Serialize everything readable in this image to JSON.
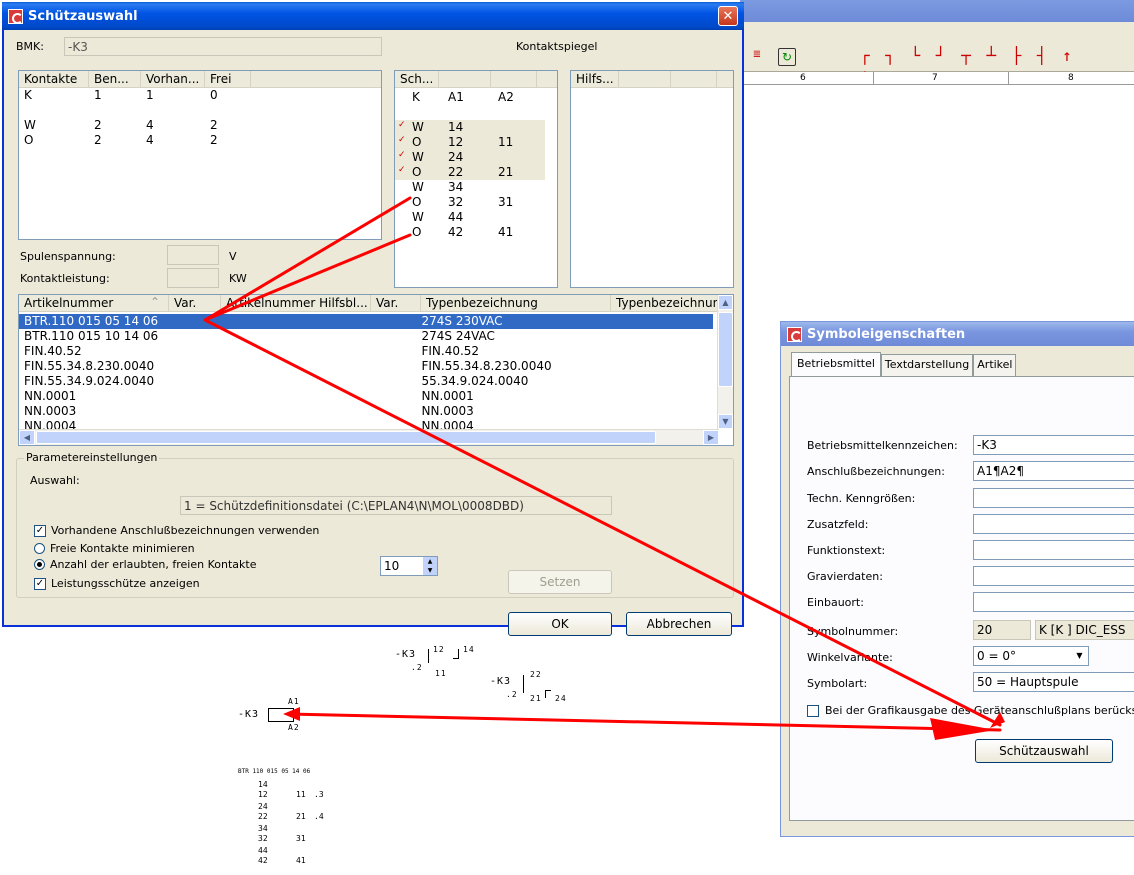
{
  "dialog": {
    "title": "Schützauswahl",
    "bmk_label": "BMK:",
    "bmk_value": "-K3",
    "kontaktspiegel_label": "Kontaktspiegel",
    "contacts_headers": [
      "Kontakte",
      "Ben...",
      "Vorhan...",
      "Frei"
    ],
    "contacts_rows": [
      [
        "K",
        "1",
        "1",
        "0"
      ],
      [
        "",
        "",
        "",
        ""
      ],
      [
        "W",
        "2",
        "4",
        "2"
      ],
      [
        "O",
        "2",
        "4",
        "2"
      ]
    ],
    "spulenspannung_label": "Spulenspannung:",
    "spulenspannung_unit": "V",
    "kontaktleistung_label": "Kontaktleistung:",
    "kontaktleistung_unit": "KW",
    "mirror_headers": [
      "Sch...",
      "",
      ""
    ],
    "mirror_rows": [
      {
        "check": "",
        "c": [
          "K",
          "A1",
          "A2"
        ],
        "hl": false
      },
      {
        "check": "",
        "c": [
          "",
          "",
          ""
        ],
        "hl": false
      },
      {
        "check": "✓",
        "c": [
          "W",
          "14",
          ""
        ],
        "hl": true
      },
      {
        "check": "✓",
        "c": [
          "O",
          "12",
          "11"
        ],
        "hl": true
      },
      {
        "check": "✓",
        "c": [
          "W",
          "24",
          ""
        ],
        "hl": true
      },
      {
        "check": "✓",
        "c": [
          "O",
          "22",
          "21"
        ],
        "hl": true
      },
      {
        "check": "",
        "c": [
          "W",
          "34",
          ""
        ],
        "hl": false
      },
      {
        "check": "",
        "c": [
          "O",
          "32",
          "31"
        ],
        "hl": false
      },
      {
        "check": "",
        "c": [
          "W",
          "44",
          ""
        ],
        "hl": false
      },
      {
        "check": "",
        "c": [
          "O",
          "42",
          "41"
        ],
        "hl": false
      }
    ],
    "aux_headers": [
      "Hilfs...",
      "",
      ""
    ],
    "articles_headers": [
      "Artikelnummer",
      "Var.",
      "Artikelnummer Hilfsbl...",
      "Var.",
      "Typenbezeichnung",
      "Typenbezeichnun"
    ],
    "articles_rows": [
      [
        "BTR.110 015 05 14 06",
        "",
        "",
        "",
        "274S 230VAC",
        ""
      ],
      [
        "BTR.110 015 10 14 06",
        "",
        "",
        "",
        "274S 24VAC",
        ""
      ],
      [
        "FIN.40.52",
        "",
        "",
        "",
        "FIN.40.52",
        ""
      ],
      [
        "FIN.55.34.8.230.0040",
        "",
        "",
        "",
        "FIN.55.34.8.230.0040",
        ""
      ],
      [
        "FIN.55.34.9.024.0040",
        "",
        "",
        "",
        "55.34.9.024.0040",
        ""
      ],
      [
        "NN.0001",
        "",
        "",
        "",
        "NN.0001",
        ""
      ],
      [
        "NN.0003",
        "",
        "",
        "",
        "NN.0003",
        ""
      ],
      [
        "NN.0004",
        "",
        "",
        "",
        "NN.0004",
        ""
      ]
    ],
    "param_group": "Parametereinstellungen",
    "auswahl_label": "Auswahl:",
    "auswahl_value": "1 = Schützdefinitionsdatei (C:\\EPLAN4\\N\\MOL\\0008DBD)",
    "opt_vorhandene": "Vorhandene Anschlußbezeichnungen verwenden",
    "opt_freie": "Freie Kontakte minimieren",
    "opt_anzahl": "Anzahl der erlaubten, freien Kontakte",
    "opt_leistung": "Leistungsschütze anzeigen",
    "anzahl_value": "10",
    "setzen": "Setzen",
    "ok": "OK",
    "abbrechen": "Abbrechen"
  },
  "symbol": {
    "title": "Symboleigenschaften",
    "tabs": [
      "Betriebsmittel",
      "Textdarstellung",
      "Artikel"
    ],
    "fields": [
      {
        "label": "Betriebsmittelkennzeichen:",
        "value": "-K3"
      },
      {
        "label": "Anschlußbezeichnungen:",
        "value": "A1¶A2¶"
      },
      {
        "label": "Techn. Kenngrößen:",
        "value": ""
      },
      {
        "label": "Zusatzfeld:",
        "value": ""
      },
      {
        "label": "Funktionstext:",
        "value": ""
      },
      {
        "label": "Gravierdaten:",
        "value": ""
      },
      {
        "label": "Einbauort:",
        "value": ""
      }
    ],
    "symbolnummer_label": "Symbolnummer:",
    "symbolnummer_value": "20",
    "symbolnummer_extra": "K [K  ] DIC_ESS",
    "winkel_label": "Winkelvariante:",
    "winkel_value": "0 = 0°",
    "symbolart_label": "Symbolart:",
    "symbolart_value": "50 = Hauptspule",
    "grafik_label": "Bei der Grafikausgabe des Geräteanschlußplans berücksichtigen",
    "schuetz_button": "Schützauswahl"
  },
  "background": {
    "ruler": [
      "6",
      "7",
      "8"
    ],
    "cad": {
      "k3a": "-K3",
      "k3a_12": "12",
      "k3a_14": "14",
      "k3a_2": ".2",
      "k3a_11": "11",
      "k3b": "-K3",
      "k3b_22": "22",
      "k3b_2": ".2",
      "k3b_21": "21",
      "k3b_24": "24",
      "coil": "-K3",
      "a1": "A1",
      "a2": "A2",
      "mirror_title": "BTR 110 015 05 14 06",
      "m14": "14",
      "m12": "12",
      "m11": "11",
      "m3": ".3",
      "m24": "24",
      "m22": "22",
      "m21": "21",
      "m4": ".4",
      "m34": "34",
      "m32": "32",
      "m31": "31",
      "m44": "44",
      "m42": "42",
      "m41": "41"
    }
  },
  "colors": {
    "selection": "#316ac5",
    "arrow": "#ff0000",
    "titlebar": "#0054e3"
  }
}
